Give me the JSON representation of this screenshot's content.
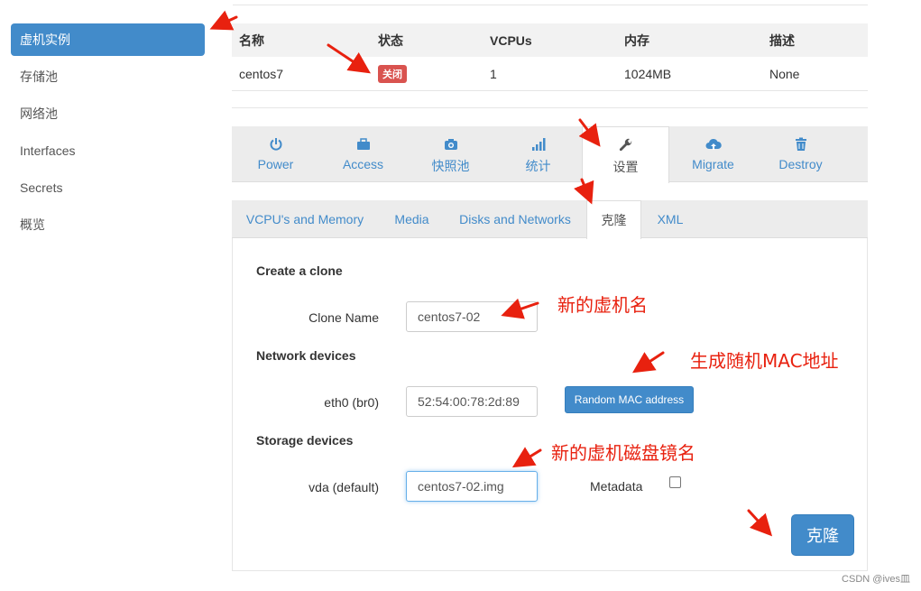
{
  "sidebar": {
    "items": [
      {
        "label": "虚机实例"
      },
      {
        "label": "存储池"
      },
      {
        "label": "网络池"
      },
      {
        "label": "Interfaces"
      },
      {
        "label": "Secrets"
      },
      {
        "label": "概览"
      }
    ]
  },
  "instance_table": {
    "headers": [
      "名称",
      "状态",
      "VCPUs",
      "内存",
      "描述"
    ],
    "row": {
      "name": "centos7",
      "status": "关闭",
      "vcpus": "1",
      "memory": "1024MB",
      "description": "None"
    }
  },
  "tabs": [
    {
      "label": "Power",
      "icon": "power-icon"
    },
    {
      "label": "Access",
      "icon": "briefcase-icon"
    },
    {
      "label": "快照池",
      "icon": "camera-icon"
    },
    {
      "label": "统计",
      "icon": "signal-bars-icon"
    },
    {
      "label": "设置",
      "icon": "wrench-icon"
    },
    {
      "label": "Migrate",
      "icon": "cloud-upload-icon"
    },
    {
      "label": "Destroy",
      "icon": "trash-icon"
    }
  ],
  "subtabs": [
    {
      "label": "VCPU's and Memory"
    },
    {
      "label": "Media"
    },
    {
      "label": "Disks and Networks"
    },
    {
      "label": "克隆"
    },
    {
      "label": "XML"
    }
  ],
  "clone": {
    "title": "Create a clone",
    "clone_name_label": "Clone Name",
    "clone_name_value": "centos7-02",
    "network_title": "Network devices",
    "nic_label": "eth0 (br0)",
    "nic_value": "52:54:00:78:2d:89",
    "random_mac_label": "Random MAC address",
    "storage_title": "Storage devices",
    "disk_label": "vda (default)",
    "disk_value": "centos7-02.img",
    "metadata_label": "Metadata",
    "metadata_checked": false,
    "submit_label": "克隆"
  },
  "annotations": {
    "new_vm_name": "新的虚机名",
    "random_mac": "生成随机MAC地址",
    "new_disk_name": "新的虚机磁盘镜名"
  },
  "colors": {
    "accent": "#428bca",
    "danger": "#d9534f",
    "annotation": "#e8210f"
  },
  "watermark": "CSDN @ives皿"
}
